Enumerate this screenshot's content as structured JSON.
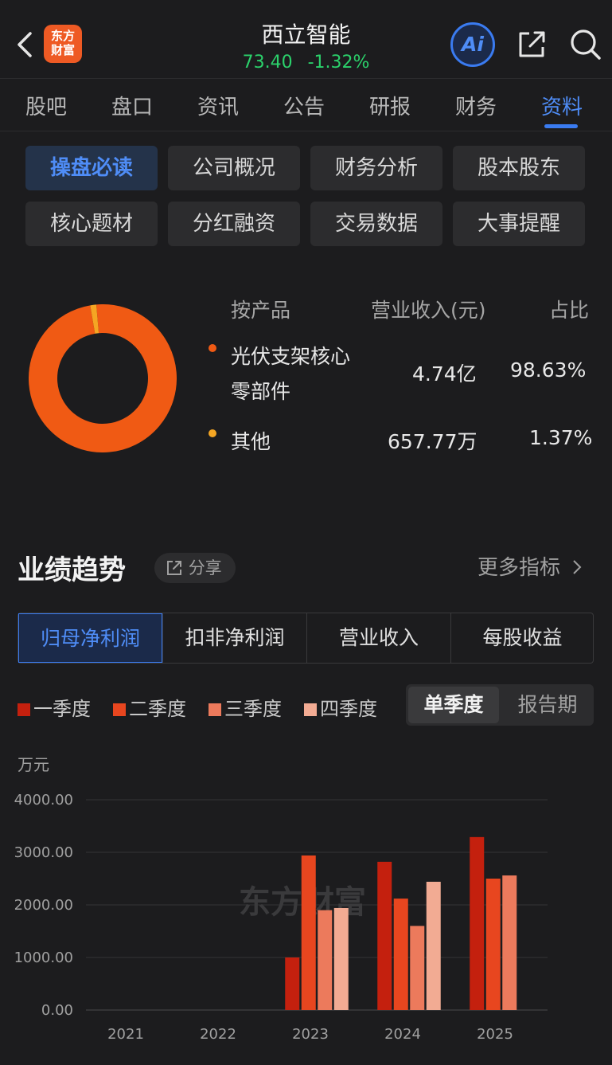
{
  "header": {
    "title": "西立智能",
    "price": "73.40",
    "change": "-1.32%",
    "logo_text": [
      "东方",
      "财富"
    ],
    "ai_label": "Ai"
  },
  "tabs": [
    {
      "label": "股吧"
    },
    {
      "label": "盘口"
    },
    {
      "label": "资讯"
    },
    {
      "label": "公告"
    },
    {
      "label": "研报"
    },
    {
      "label": "财务"
    },
    {
      "label": "资料",
      "active": true
    }
  ],
  "subtabs": [
    {
      "label": "操盘必读",
      "active": true
    },
    {
      "label": "公司概况"
    },
    {
      "label": "财务分析"
    },
    {
      "label": "股本股东"
    },
    {
      "label": "核心题材"
    },
    {
      "label": "分红融资"
    },
    {
      "label": "交易数据"
    },
    {
      "label": "大事提醒"
    }
  ],
  "revenue": {
    "headers": [
      "按产品",
      "营业收入(元)",
      "占比"
    ],
    "rows": [
      {
        "name_lines": [
          "光伏支架核心",
          "零部件"
        ],
        "amount": "4.74亿",
        "pct": "98.63%",
        "pct_value": 98.63,
        "color": "#f05a14"
      },
      {
        "name_lines": [
          "其他"
        ],
        "amount": "657.77万",
        "pct": "1.37%",
        "pct_value": 1.37,
        "color": "#f5a623"
      }
    ]
  },
  "performance": {
    "title": "业绩趋势",
    "share_label": "分享",
    "more_label": "更多指标",
    "metric_tabs": [
      {
        "label": "归母净利润",
        "active": true
      },
      {
        "label": "扣非净利润"
      },
      {
        "label": "营业收入"
      },
      {
        "label": "每股收益"
      }
    ],
    "legend": [
      {
        "label": "一季度",
        "color": "#c4200e"
      },
      {
        "label": "二季度",
        "color": "#e8461f"
      },
      {
        "label": "三季度",
        "color": "#ec7a5c"
      },
      {
        "label": "四季度",
        "color": "#f2ab93"
      }
    ],
    "period_options": [
      {
        "label": "单季度",
        "active": true
      },
      {
        "label": "报告期"
      }
    ],
    "unit": "万元",
    "watermark": "东方财富"
  },
  "chart_data": {
    "type": "bar",
    "categories": [
      "2021",
      "2022",
      "2023",
      "2024",
      "2025"
    ],
    "series": [
      {
        "name": "一季度",
        "values": [
          null,
          null,
          1000,
          2820,
          3290
        ]
      },
      {
        "name": "二季度",
        "values": [
          null,
          null,
          2940,
          2120,
          2500
        ]
      },
      {
        "name": "三季度",
        "values": [
          null,
          null,
          1900,
          1600,
          2560
        ]
      },
      {
        "name": "四季度",
        "values": [
          null,
          null,
          1940,
          2440,
          null
        ]
      }
    ],
    "ylabel": "万元",
    "yticks": [
      "0.00",
      "1000.00",
      "2000.00",
      "3000.00",
      "4000.00"
    ],
    "ylim": [
      0,
      4000
    ],
    "grid": true
  }
}
